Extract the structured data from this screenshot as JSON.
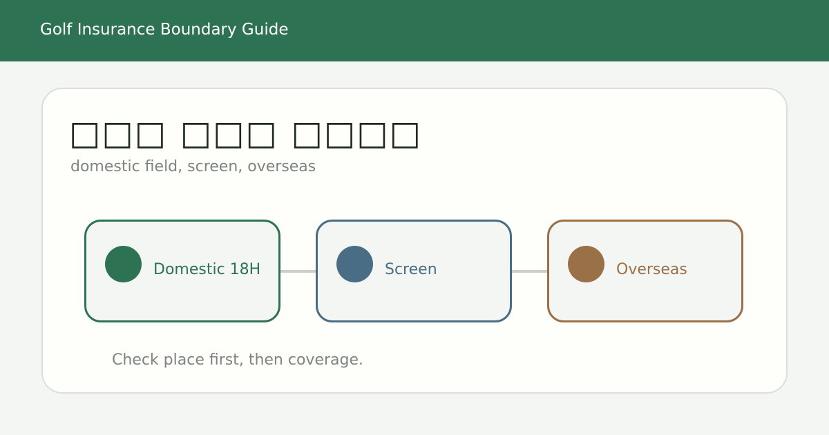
{
  "header": {
    "title": "Golf Insurance Boundary Guide"
  },
  "card": {
    "title": "□□□ □□□ □□□□",
    "subtitle": "domestic field, screen, overseas",
    "note": "Check place first, then coverage."
  },
  "nodes": [
    {
      "label": "Domestic 18H",
      "color": "#2d7253"
    },
    {
      "label": "Screen",
      "color": "#486d84"
    },
    {
      "label": "Overseas",
      "color": "#9a7048"
    }
  ],
  "colors": {
    "header_bg": "#2d7253",
    "connector": "#cccfc9"
  }
}
